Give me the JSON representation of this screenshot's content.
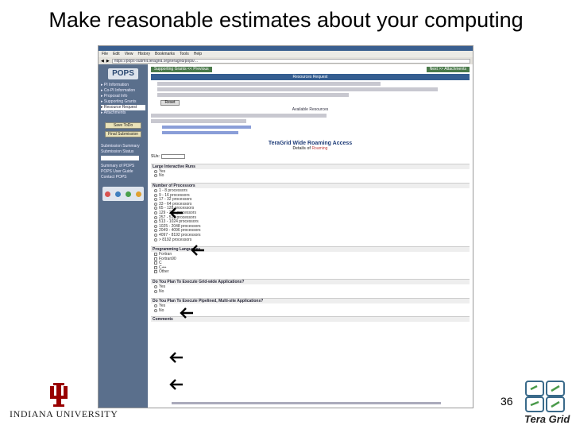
{
  "slide": {
    "title": "Make reasonable estimates about your computing",
    "page_number": "36",
    "footer_left": "INDIANA UNIVERSITY",
    "footer_right": "Tera Grid"
  },
  "screenshot": {
    "menu": [
      "File",
      "Edit",
      "View",
      "History",
      "Bookmarks",
      "Tools",
      "Help"
    ],
    "url": "https://pops-submit.teragrid.org/teragrid/pops/...",
    "sidebar": {
      "logo": "POPS",
      "items": [
        "PI Information",
        "Co-PI Information",
        "Proposal Info",
        "Supporting Grants",
        "Resource Request",
        "Attachments"
      ],
      "active_index": 4,
      "buttons": [
        "Save ToDo",
        "Final Submission"
      ],
      "links": [
        "Submission Summary",
        "Submission Status"
      ],
      "more_links": [
        "Summary of POPS",
        "POPS User Guide",
        "Contact POPS"
      ]
    },
    "main": {
      "top_left": "Supporting Grants << Previous",
      "top_right": "Next >> Attachments",
      "header": "Resources Request",
      "reset_label": "Reset",
      "available_title": "Available Resources",
      "roaming_title": "TeraGrid Wide Roaming Access",
      "roaming_sub": "Details of",
      "roaming_link": "Roaming",
      "su_label": "SUs:",
      "sections": [
        {
          "title": "Large Interactive Runs",
          "type": "radio",
          "options": [
            "Yes",
            "No"
          ]
        },
        {
          "title": "Number of Processors",
          "type": "radio",
          "options": [
            "1 - 8 processors",
            "9 - 16 processors",
            "17 - 32 processors",
            "33 - 64 processors",
            "65 - 128 processors",
            "129 - 256 processors",
            "257 - 512 processors",
            "513 - 1024 processors",
            "1025 - 2048 processors",
            "2049 - 4096 processors",
            "4097 - 8192 processors",
            "> 8192 processors"
          ]
        },
        {
          "title": "Programming Languages",
          "type": "check",
          "options": [
            "Fortran",
            "Fortran90",
            "C",
            "C++",
            "Other"
          ]
        },
        {
          "title": "Do You Plan To Execute Grid-wide Applications?",
          "type": "radio",
          "options": [
            "Yes",
            "No"
          ]
        },
        {
          "title": "Do You Plan To Execute Pipelined, Multi-site Applications?",
          "type": "radio",
          "options": [
            "Yes",
            "No"
          ]
        }
      ],
      "comments_label": "Comments"
    }
  }
}
